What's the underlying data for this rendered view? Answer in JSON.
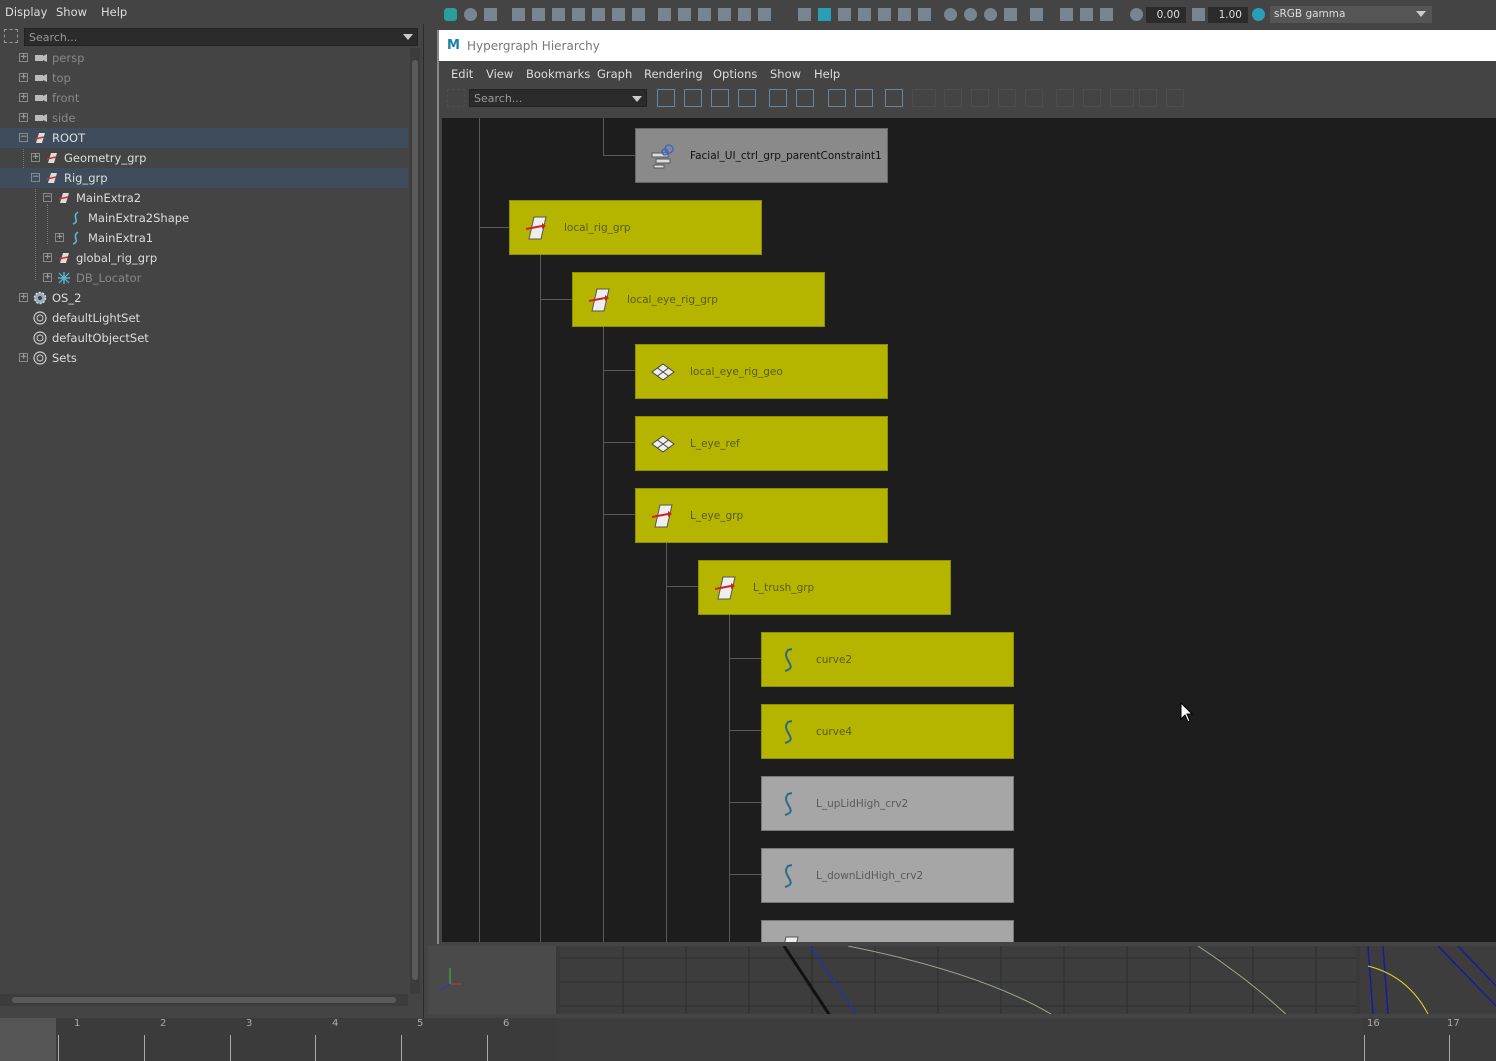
{
  "outliner": {
    "menu": [
      "Display",
      "Show",
      "Help"
    ],
    "search_placeholder": "Search...",
    "items": [
      {
        "label": "persp",
        "dim": true
      },
      {
        "label": "top",
        "dim": true
      },
      {
        "label": "front",
        "dim": true
      },
      {
        "label": "side",
        "dim": true
      },
      {
        "label": "ROOT",
        "selected": true
      },
      {
        "label": "Geometry_grp"
      },
      {
        "label": "Rig_grp",
        "selected": true
      },
      {
        "label": "MainExtra2"
      },
      {
        "label": "MainExtra2Shape"
      },
      {
        "label": "MainExtra1"
      },
      {
        "label": "global_rig_grp"
      },
      {
        "label": "DB_Locator",
        "dim": true
      },
      {
        "label": "OS_2"
      },
      {
        "label": "defaultLightSet"
      },
      {
        "label": "defaultObjectSet"
      },
      {
        "label": "Sets"
      }
    ]
  },
  "toolbar": {
    "exposure": "0.00",
    "gamma_value": "1.00",
    "colorspace": "sRGB gamma"
  },
  "hypergraph": {
    "title": "Hypergraph Hierarchy",
    "menu": [
      "Edit",
      "View",
      "Bookmarks",
      "Graph",
      "Rendering",
      "Options",
      "Show",
      "Help"
    ],
    "search_placeholder": "Search...",
    "nodes": [
      {
        "label": "Facial_UI_ctrl_grp_parentConstraint1",
        "kind": "constraint",
        "color": "dark-gray"
      },
      {
        "label": "local_rig_grp",
        "kind": "transform",
        "color": "yellow"
      },
      {
        "label": "local_eye_rig_grp",
        "kind": "transform",
        "color": "yellow"
      },
      {
        "label": "local_eye_rig_geo",
        "kind": "mesh",
        "color": "yellow"
      },
      {
        "label": "L_eye_ref",
        "kind": "mesh",
        "color": "yellow"
      },
      {
        "label": "L_eye_grp",
        "kind": "transform",
        "color": "yellow"
      },
      {
        "label": "L_trush_grp",
        "kind": "transform",
        "color": "yellow"
      },
      {
        "label": "curve2",
        "kind": "curve",
        "color": "yellow"
      },
      {
        "label": "curve4",
        "kind": "curve",
        "color": "yellow"
      },
      {
        "label": "L_upLidHigh_crv2",
        "kind": "curve",
        "color": "gray"
      },
      {
        "label": "L_downLidHigh_crv2",
        "kind": "curve",
        "color": "gray"
      },
      {
        "label": "",
        "kind": "transform",
        "color": "gray"
      }
    ]
  },
  "timeline": {
    "ticks": [
      "1",
      "2",
      "3",
      "4",
      "5",
      "6",
      "16",
      "17"
    ]
  },
  "colors": {
    "selected_node": "#b5b500",
    "unselected_node": "#a6a6a6",
    "canvas": "#1d1d1d"
  }
}
